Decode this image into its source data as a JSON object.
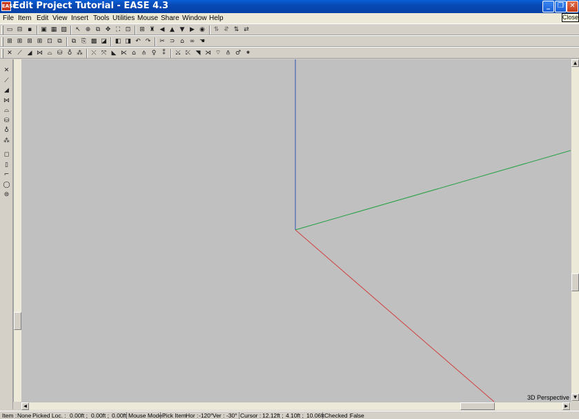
{
  "window": {
    "title": "Edit Project Tutorial - EASE 4.3",
    "icon_label": "EASE",
    "min_glyph": "_",
    "max_glyph": "❐",
    "close_glyph": "✕",
    "close_tooltip": "Close"
  },
  "menu": [
    "File",
    "Item",
    "Edit",
    "View",
    "Insert",
    "Tools",
    "Utilities",
    "Mouse",
    "Share",
    "Window",
    "Help"
  ],
  "viewport": {
    "label": "3D Perspective",
    "background": "#c0c0c0",
    "axis_colors": {
      "x": "#d04040",
      "y": "#20a040",
      "z": "#3050b0"
    }
  },
  "scroll": {
    "up": "▲",
    "down": "▼",
    "left": "◀",
    "right": "▶"
  },
  "statusbar": {
    "item_label": "Item :",
    "item_value": "None",
    "picked_label": "Picked Loc. :",
    "picked_x": "0.00ft ;",
    "picked_y": "0.00ft ;",
    "picked_z": "0.00ft",
    "mode_label": "Mouse Mode :",
    "mode_value": "Pick Item",
    "hor_label": "Hor :",
    "hor_value": "-120°",
    "ver_label": "Ver :",
    "ver_value": "-30°",
    "cursor_label": "Cursor :",
    "cursor_x": "12.12ft ;",
    "cursor_y": "4.10ft ;",
    "cursor_z": "10.06ft",
    "checked_label": "Checked :",
    "checked_value": "False"
  },
  "toolbars": {
    "row1": [
      {
        "name": "open-icon",
        "glyph": "▭"
      },
      {
        "name": "open-folder-icon",
        "glyph": "⊟"
      },
      {
        "name": "save-icon",
        "glyph": "▪"
      },
      {
        "name": "view-model-icon",
        "glyph": "▣"
      },
      {
        "name": "view-render-icon",
        "glyph": "▦"
      },
      {
        "name": "view-mapping-icon",
        "glyph": "▧"
      },
      {
        "name": "pointer-icon",
        "glyph": "↖"
      },
      {
        "name": "rotate-icon",
        "glyph": "⊕"
      },
      {
        "name": "zoom-icon",
        "glyph": "⧉"
      },
      {
        "name": "pan-icon",
        "glyph": "✥"
      },
      {
        "name": "zoom-window-icon",
        "glyph": "⛶"
      },
      {
        "name": "zoom-fit-icon",
        "glyph": "⊡"
      },
      {
        "name": "grid-icon",
        "glyph": "⊞"
      },
      {
        "name": "speaker-array-icon",
        "glyph": "♜"
      },
      {
        "name": "arrow-left-icon",
        "glyph": "◀"
      },
      {
        "name": "arrow-up-icon",
        "glyph": "▲"
      },
      {
        "name": "arrow-down-icon",
        "glyph": "▼"
      },
      {
        "name": "arrow-right-icon",
        "glyph": "▶"
      },
      {
        "name": "center-icon",
        "glyph": "◉"
      },
      {
        "name": "mirror-x-icon",
        "glyph": "⥮"
      },
      {
        "name": "mirror-y-icon",
        "glyph": "⥯"
      },
      {
        "name": "mirror-z-icon",
        "glyph": "⇅"
      },
      {
        "name": "mirror-all-icon",
        "glyph": "⇄"
      }
    ],
    "row2": [
      {
        "name": "layout-1-icon",
        "glyph": "⊞"
      },
      {
        "name": "layout-2-icon",
        "glyph": "⊞"
      },
      {
        "name": "layout-3-icon",
        "glyph": "⊞"
      },
      {
        "name": "layout-4-icon",
        "glyph": "⊞"
      },
      {
        "name": "layout-5-icon",
        "glyph": "⊡"
      },
      {
        "name": "layout-6-icon",
        "glyph": "⧉"
      },
      {
        "name": "copy-icon",
        "glyph": "⧉"
      },
      {
        "name": "paste-icon",
        "glyph": "⎘"
      },
      {
        "name": "picture-icon",
        "glyph": "▩"
      },
      {
        "name": "check-icon",
        "glyph": "◪"
      },
      {
        "name": "face-icon",
        "glyph": "◧"
      },
      {
        "name": "face-flip-icon",
        "glyph": "◨"
      },
      {
        "name": "undo-icon",
        "glyph": "↶"
      },
      {
        "name": "redo-icon",
        "glyph": "↷"
      },
      {
        "name": "cut-icon",
        "glyph": "✂"
      },
      {
        "name": "join-icon",
        "glyph": "⊃"
      },
      {
        "name": "seat-icon",
        "glyph": "⌂"
      },
      {
        "name": "binoculars-icon",
        "glyph": "∞"
      },
      {
        "name": "hand-icon",
        "glyph": "☚"
      }
    ],
    "row3": [
      {
        "name": "delete-icon",
        "glyph": "✕"
      },
      {
        "name": "vertex-icon",
        "glyph": "⟋"
      },
      {
        "name": "face-insert-icon",
        "glyph": "◢"
      },
      {
        "name": "edge-icon",
        "glyph": "⋈"
      },
      {
        "name": "area-icon",
        "glyph": "⌓"
      },
      {
        "name": "seat-insert-icon",
        "glyph": "⛁"
      },
      {
        "name": "light-icon",
        "glyph": "♁"
      },
      {
        "name": "loudspeaker-icon",
        "glyph": "⁂"
      },
      {
        "name": "delete-vertex-icon",
        "glyph": "⤬"
      },
      {
        "name": "split-icon",
        "glyph": "⤧"
      },
      {
        "name": "face-split-icon",
        "glyph": "◣"
      },
      {
        "name": "edge-split-icon",
        "glyph": "⋉"
      },
      {
        "name": "seat-split-icon",
        "glyph": "⌂"
      },
      {
        "name": "merge-icon",
        "glyph": "⫛"
      },
      {
        "name": "light-split-icon",
        "glyph": "♀"
      },
      {
        "name": "speaker-split-icon",
        "glyph": "⁑"
      },
      {
        "name": "sel-vertex-icon",
        "glyph": "⤩"
      },
      {
        "name": "sel-edge-icon",
        "glyph": "⤪"
      },
      {
        "name": "sel-face-icon",
        "glyph": "◥"
      },
      {
        "name": "sel-seat-icon",
        "glyph": "⋊"
      },
      {
        "name": "sel-area-icon",
        "glyph": "⌔"
      },
      {
        "name": "sel-group-icon",
        "glyph": "⫚"
      },
      {
        "name": "sel-light-icon",
        "glyph": "♂"
      },
      {
        "name": "sel-speaker-icon",
        "glyph": "⁕"
      }
    ],
    "left": [
      {
        "name": "delete-item-icon",
        "glyph": "✕"
      },
      {
        "name": "insert-vertex-icon",
        "glyph": "⟋"
      },
      {
        "name": "insert-face-icon",
        "glyph": "◢"
      },
      {
        "name": "insert-edge-icon",
        "glyph": "⋈"
      },
      {
        "name": "insert-area-icon",
        "glyph": "⌓"
      },
      {
        "name": "insert-seat-icon",
        "glyph": "⛁"
      },
      {
        "name": "insert-light-icon",
        "glyph": "♁"
      },
      {
        "name": "insert-speaker-icon",
        "glyph": "⁂"
      },
      {
        "name": "box-icon",
        "glyph": "◻"
      },
      {
        "name": "cube-icon",
        "glyph": "▯"
      },
      {
        "name": "stairs-icon",
        "glyph": "⌐"
      },
      {
        "name": "cylinder-icon",
        "glyph": "◯"
      },
      {
        "name": "dome-icon",
        "glyph": "⊜"
      }
    ]
  }
}
